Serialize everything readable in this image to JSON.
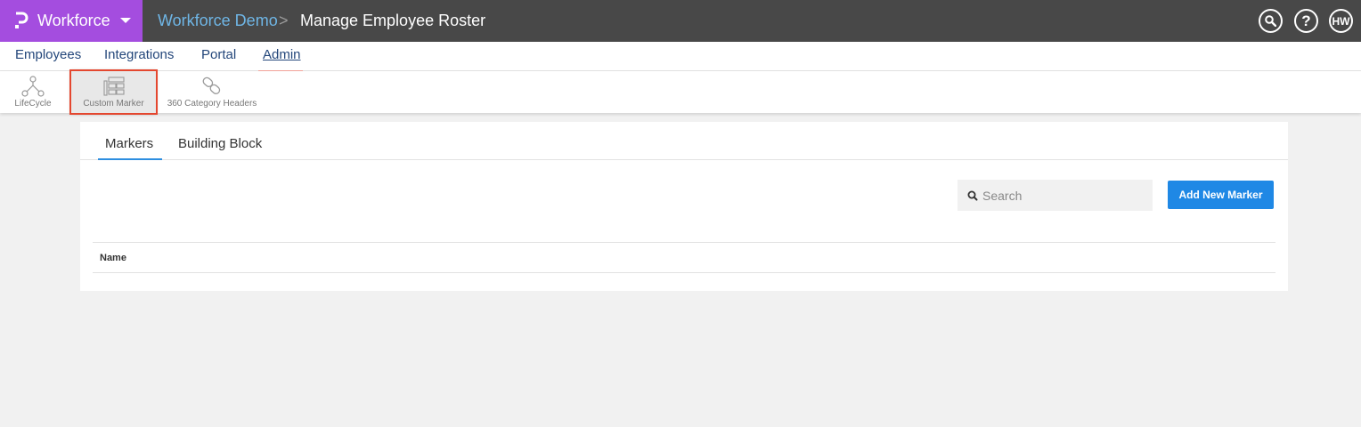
{
  "topbar": {
    "brand": {
      "name": "Workforce",
      "logo_icon": "p-logo-icon",
      "color": "#a44ddf"
    },
    "breadcrumb": {
      "link": "Workforce Demo",
      "separator": ">",
      "current": "Manage Employee Roster"
    },
    "icons": {
      "search": "search-icon",
      "help": "?",
      "avatar": "HW"
    },
    "background": "#484848"
  },
  "nav": {
    "items": [
      {
        "label": "Employees"
      },
      {
        "label": "Integrations"
      },
      {
        "label": "Portal"
      },
      {
        "label": "Admin",
        "active": true
      }
    ]
  },
  "subbar": {
    "items": [
      {
        "label": "LifeCycle",
        "icon": "lifecycle-icon"
      },
      {
        "label": "Custom Marker",
        "icon": "custom-marker-icon",
        "selected": true
      },
      {
        "label": "360 Category Headers",
        "icon": "chain-link-icon"
      }
    ]
  },
  "main": {
    "tabs": [
      {
        "label": "Markers",
        "active": true
      },
      {
        "label": "Building Block"
      }
    ],
    "search": {
      "placeholder": "Search",
      "value": ""
    },
    "add_button": "Add New Marker",
    "table": {
      "columns": [
        "Name"
      ]
    },
    "accent": "#1f88e5"
  }
}
